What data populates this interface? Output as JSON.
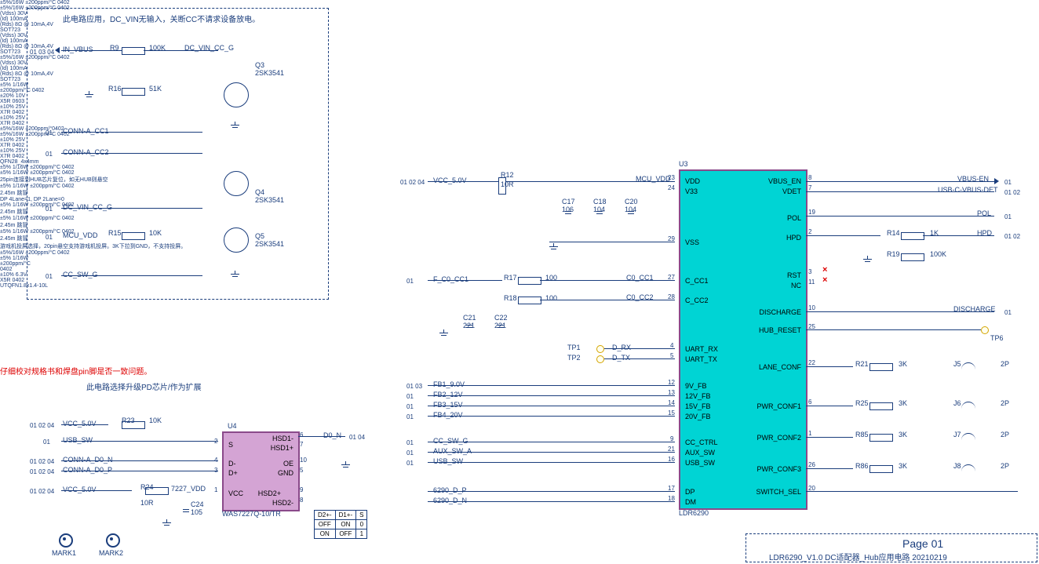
{
  "title_block": {
    "page": "Page 01",
    "title": "LDR6290_V1.0 DC适配器_Hub应用电路 20210219"
  },
  "notes": {
    "top": "此电路应用，DC_VIN无输入，关断CC不请求设备放电。",
    "red": "仔细校对规格书和焊盘pin脚是否一致问题。",
    "blue": "此电路选择升级PD芯片/作为扩展",
    "lane": "DP 4Lane=1, DP 2Lane=0",
    "hub": "25pin连接到HUB芯片复位，如无HUB则悬空",
    "switch": "游戏机投屏选择，20pin悬空支持游戏机投屏。3K下拉到GND，不支持投屏。"
  },
  "u3": {
    "ref": "U3",
    "val": "LDR6290",
    "pkg": "QFN28_4x4mm",
    "left_pins": [
      {
        "no": "23",
        "name": "VDD"
      },
      {
        "no": "24",
        "name": "V33"
      },
      {
        "no": "29",
        "name": "VSS"
      },
      {
        "no": "27",
        "name": "C_CC1"
      },
      {
        "no": "28",
        "name": "C_CC2"
      },
      {
        "no": "4",
        "name": "UART_RX"
      },
      {
        "no": "5",
        "name": "UART_TX"
      },
      {
        "no": "12",
        "name": "9V_FB"
      },
      {
        "no": "13",
        "name": "12V_FB"
      },
      {
        "no": "14",
        "name": "15V_FB"
      },
      {
        "no": "15",
        "name": "20V_FB"
      },
      {
        "no": "9",
        "name": "CC_CTRL"
      },
      {
        "no": "21",
        "name": "AUX_SW"
      },
      {
        "no": "16",
        "name": "USB_SW"
      },
      {
        "no": "17",
        "name": "DP"
      },
      {
        "no": "18",
        "name": "DM"
      }
    ],
    "right_pins": [
      {
        "no": "8",
        "name": "VBUS_EN"
      },
      {
        "no": "7",
        "name": "VDET"
      },
      {
        "no": "19",
        "name": "POL"
      },
      {
        "no": "2",
        "name": "HPD"
      },
      {
        "no": "3",
        "name": "RST"
      },
      {
        "no": "11",
        "name": "NC"
      },
      {
        "no": "10",
        "name": "DISCHARGE"
      },
      {
        "no": "25",
        "name": "HUB_RESET"
      },
      {
        "no": "22",
        "name": "LANE_CONF"
      },
      {
        "no": "6",
        "name": "PWR_CONF1"
      },
      {
        "no": "1",
        "name": "PWR_CONF2"
      },
      {
        "no": "26",
        "name": "PWR_CONF3"
      },
      {
        "no": "20",
        "name": "SWITCH_SEL"
      }
    ]
  },
  "u4": {
    "ref": "U4",
    "val": "WAS7227Q-10/TR",
    "pkg": "UTQFN1.8x1.4-10L",
    "pins": [
      {
        "no": "2",
        "name": "S"
      },
      {
        "no": "6",
        "name": "HSD1-"
      },
      {
        "no": "7",
        "name": "HSD1+"
      },
      {
        "no": "4",
        "name": "D-"
      },
      {
        "no": "3",
        "name": "D+"
      },
      {
        "no": "10",
        "name": "OE"
      },
      {
        "no": "5",
        "name": "GND"
      },
      {
        "no": "1",
        "name": "VCC"
      },
      {
        "no": "9",
        "name": "HSD2+"
      },
      {
        "no": "8",
        "name": "HSD2-"
      }
    ]
  },
  "mosfets": {
    "Q3": {
      "val": "2SK3541",
      "spec": [
        "(Vdss) 30V",
        "(Id) 100mA",
        "(Rds) 8Ω @ 10mA,4V",
        "SOT723"
      ]
    },
    "Q4": {
      "val": "2SK3541",
      "spec": [
        "(Vdss) 30V",
        "(Id) 100mA",
        "(Rds) 8Ω @ 10mA,4V",
        "SOT723"
      ]
    },
    "Q5": {
      "val": "2SK3541",
      "spec": [
        "(Vdss) 30V",
        "(Id) 100mA",
        "(Rds) 8Ω @ 10mA,4V",
        "SOT723"
      ]
    }
  },
  "resistors": {
    "R9": {
      "val": "100K",
      "spec": "±5%/16W  ±200ppm/°C  0402"
    },
    "R16": {
      "val": "51K",
      "spec": "±5%/16W  ±200ppm/°C  0402"
    },
    "R15": {
      "val": "10K",
      "spec": "±5%/16W  ±200ppm/°C  0402"
    },
    "R12": {
      "val": "10R",
      "spec": "±5% 1/16W ±200ppm/°C 0402"
    },
    "R17": {
      "val": "100",
      "spec": "±5%/16W  ±200ppm/°0402"
    },
    "R18": {
      "val": "100",
      "spec": "±5%/16W  ±200ppm/°C  0402"
    },
    "R14": {
      "val": "1K",
      "spec": "±5%  1/16W  ±200ppm/°C 0402"
    },
    "R19": {
      "val": "100K",
      "spec": "±5%  1/16W  ±200ppm/°C 0402"
    },
    "R21": {
      "val": "3K",
      "spec": "±5%  1/16W  ±200ppm/°C 0402"
    },
    "R25": {
      "val": "3K",
      "spec": "±5%  1/16W  ±200ppm/°C 0402"
    },
    "R85": {
      "val": "3K",
      "spec": "±5%  1/16W  ±200ppm/°C 0402"
    },
    "R86": {
      "val": "3K",
      "spec": "±5%  1/16W  ±200ppm/°C 0402"
    },
    "R23": {
      "val": "10K",
      "spec": "±5%/16W  ±200ppm/°C  0402"
    },
    "R24": {
      "val": "10R",
      "spec": "±5% 1/16W ±200ppm/°C 0402"
    }
  },
  "caps": {
    "C17": {
      "val": "106",
      "spec": "±20% 10V X5R 0603"
    },
    "C18": {
      "val": "104",
      "spec": "±10% 25V X7R 0402"
    },
    "C20": {
      "val": "104",
      "spec": "±10% 25V X7R 0402"
    },
    "C21": {
      "val": "221",
      "spec": "±10% 25V X7R 0402"
    },
    "C22": {
      "val": "221",
      "spec": "±10% 25V X7R 0402"
    },
    "C24": {
      "val": "105",
      "spec": "±10% 6.3V X5R 0402"
    }
  },
  "nets": {
    "in_vbus": "IN_VBUS",
    "dc_vin_cc_g": "DC_VIN_CC_G",
    "conn_a_cc1": "CONN-A_CC1",
    "conn_a_cc2": "CONN-A_CC2",
    "mcu_vdd": "MCU_VDD",
    "cc_sw_g": "CC_SW_G",
    "vcc_5v": "VCC_5.0V",
    "f_c0_cc1": "F_C0_CC1",
    "c0_cc1": "C0_CC1",
    "c0_cc2": "C0_CC2",
    "d_rx": "D_RX",
    "d_tx": "D_TX",
    "fb1": "FB1_9.0V",
    "fb2": "FB2_12V",
    "fb3": "FB3_15V",
    "fb4": "FB4_20V",
    "usb_sw": "USB_SW",
    "conn_a_d0_n": "CONN-A_D0_N",
    "conn_a_d0_p": "CONN-A_D0_P",
    "d0_n": "D0_N",
    "d0_p": "6290_D_P",
    "d0_n2": "6290_D_N",
    "aux_sw_a": "AUX_SW_A",
    "vbus_en": "VBUS-EN",
    "usb_c_vbus_det": "USB-C-VBUS-DET",
    "pol": "POL",
    "hpd": "HPD",
    "discharge": "DISCHARGE",
    "7227_vdd": "7227_VDD"
  },
  "jumpers": {
    "J5": {
      "val": "2P",
      "spec": "2.45m 跳冒"
    },
    "J6": {
      "val": "2P",
      "spec": "2.45m 跳冒"
    },
    "J7": {
      "val": "2P",
      "spec": "2.45m 跳冒"
    },
    "J8": {
      "val": "2P",
      "spec": "2.45m 跳冒"
    }
  },
  "tps": {
    "TP1": "TP1",
    "TP2": "TP2",
    "TP6": "TP6"
  },
  "marks": {
    "MARK1": "MARK1",
    "MARK2": "MARK2"
  },
  "table": {
    "h": [
      "D2+-",
      "D1+-",
      "S"
    ],
    "r1": [
      "OFF",
      "ON",
      "0"
    ],
    "r2": [
      "ON",
      "OFF",
      "1"
    ]
  },
  "ports": {
    "p1": "01 03 04",
    "p2": "01",
    "p3": "01",
    "p4": "01",
    "p5": "01",
    "p6": "01 02 04",
    "p7": "01 03",
    "p8": "01",
    "p9": "01 02 04",
    "p10": "01",
    "p11": "01 02 04",
    "p12": "01 02 04",
    "p13": "01 04",
    "p14": "01",
    "p15": "01",
    "p16": "01",
    "p17": "01",
    "p18": "01 02",
    "p19": "01 02"
  }
}
